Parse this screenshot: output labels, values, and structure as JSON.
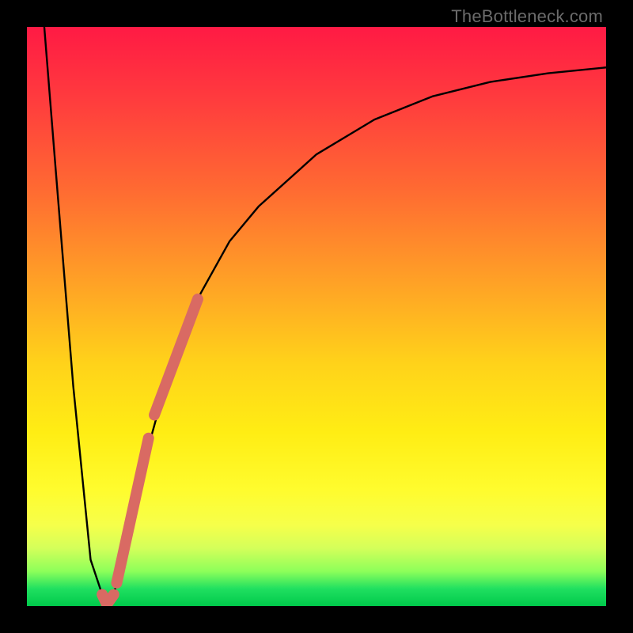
{
  "watermark": "TheBottleneck.com",
  "chart_data": {
    "type": "line",
    "title": "",
    "xlabel": "",
    "ylabel": "",
    "xlim": [
      0,
      100
    ],
    "ylim": [
      0,
      100
    ],
    "black_curve": {
      "x": [
        3,
        5,
        8,
        11,
        13,
        14,
        15,
        17,
        20,
        25,
        30,
        35,
        40,
        50,
        60,
        70,
        80,
        90,
        100
      ],
      "y": [
        100,
        75,
        38,
        8,
        2,
        0,
        2,
        10,
        24,
        42,
        54,
        63,
        69,
        78,
        84,
        88,
        90.5,
        92,
        93
      ]
    },
    "pink_segment_upper": {
      "x": [
        22.0,
        29.5
      ],
      "y": [
        33.0,
        53.0
      ]
    },
    "pink_segment_lower": {
      "x": [
        15.5,
        21.0
      ],
      "y": [
        4.0,
        29.0
      ]
    },
    "pink_hook": {
      "x": [
        13.0,
        13.8,
        15.0
      ],
      "y": [
        2.0,
        0.3,
        2.0
      ]
    },
    "gradient_stops": [
      {
        "pos": 0.0,
        "color": "#ff1a44"
      },
      {
        "pos": 0.5,
        "color": "#ffd21a"
      },
      {
        "pos": 0.95,
        "color": "#20e060"
      },
      {
        "pos": 1.0,
        "color": "#00c94b"
      }
    ]
  }
}
